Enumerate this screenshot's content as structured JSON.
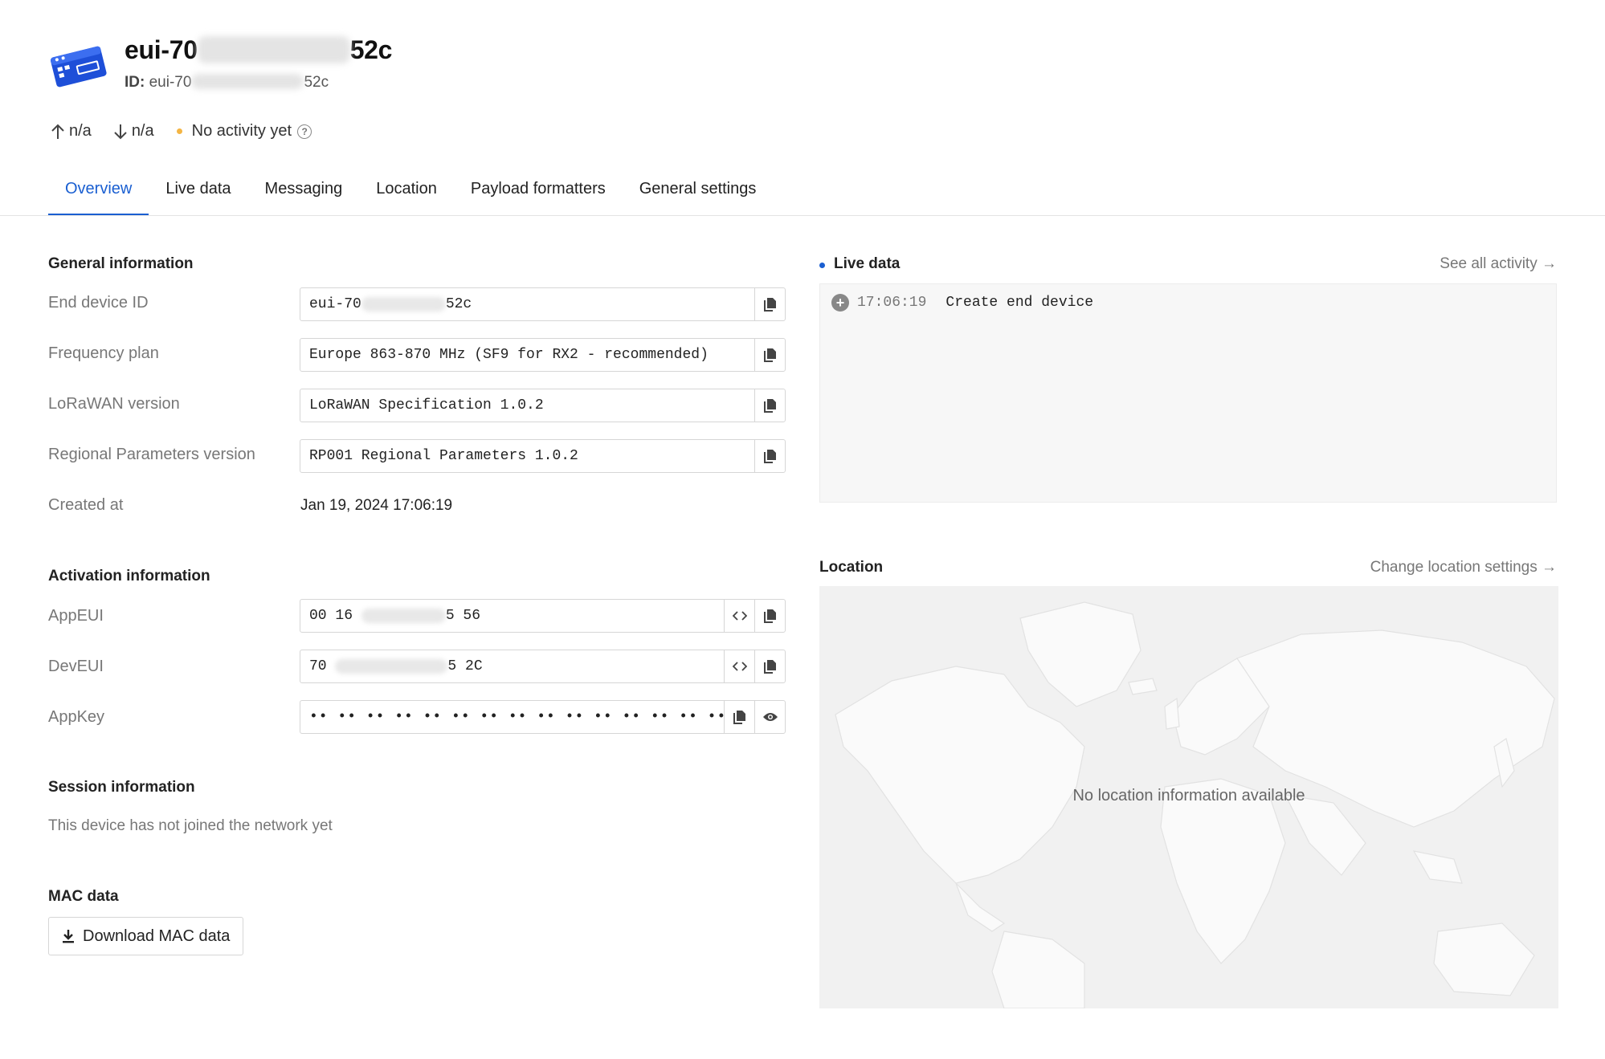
{
  "header": {
    "title_prefix": "eui-70",
    "title_suffix": "52c",
    "id_label": "ID:",
    "id_prefix": "eui-70",
    "id_suffix": "52c"
  },
  "stats": {
    "uplink": "n/a",
    "downlink": "n/a",
    "activity": "No activity yet",
    "status_color": "#f4b544"
  },
  "tabs": [
    {
      "label": "Overview",
      "active": true
    },
    {
      "label": "Live data",
      "active": false
    },
    {
      "label": "Messaging",
      "active": false
    },
    {
      "label": "Location",
      "active": false
    },
    {
      "label": "Payload formatters",
      "active": false
    },
    {
      "label": "General settings",
      "active": false
    }
  ],
  "general": {
    "heading": "General information",
    "end_device_id": {
      "label": "End device ID",
      "prefix": "eui-70",
      "suffix": "52c"
    },
    "frequency_plan": {
      "label": "Frequency plan",
      "value": "Europe 863-870 MHz (SF9 for RX2 - recommended)"
    },
    "lorawan_version": {
      "label": "LoRaWAN version",
      "value": "LoRaWAN Specification 1.0.2"
    },
    "regional_params": {
      "label": "Regional Parameters version",
      "value": "RP001 Regional Parameters 1.0.2"
    },
    "created_at": {
      "label": "Created at",
      "value": "Jan 19, 2024 17:06:19"
    }
  },
  "activation": {
    "heading": "Activation information",
    "app_eui": {
      "label": "AppEUI",
      "prefix": "00 16",
      "suffix": "5 56"
    },
    "dev_eui": {
      "label": "DevEUI",
      "prefix": "70",
      "suffix": "5 2C"
    },
    "app_key": {
      "label": "AppKey",
      "value": "•• •• •• •• •• •• •• •• •• •• •• •• •• •• •• ••"
    }
  },
  "session": {
    "heading": "Session information",
    "text": "This device has not joined the network yet"
  },
  "mac": {
    "heading": "MAC data",
    "button": "Download MAC data"
  },
  "live": {
    "heading": "Live data",
    "link": "See all activity →",
    "events": [
      {
        "time": "17:06:19",
        "message": "Create end device"
      }
    ],
    "accent": "#1a5fd1"
  },
  "location": {
    "heading": "Location",
    "link": "Change location settings →",
    "empty": "No location information available"
  }
}
